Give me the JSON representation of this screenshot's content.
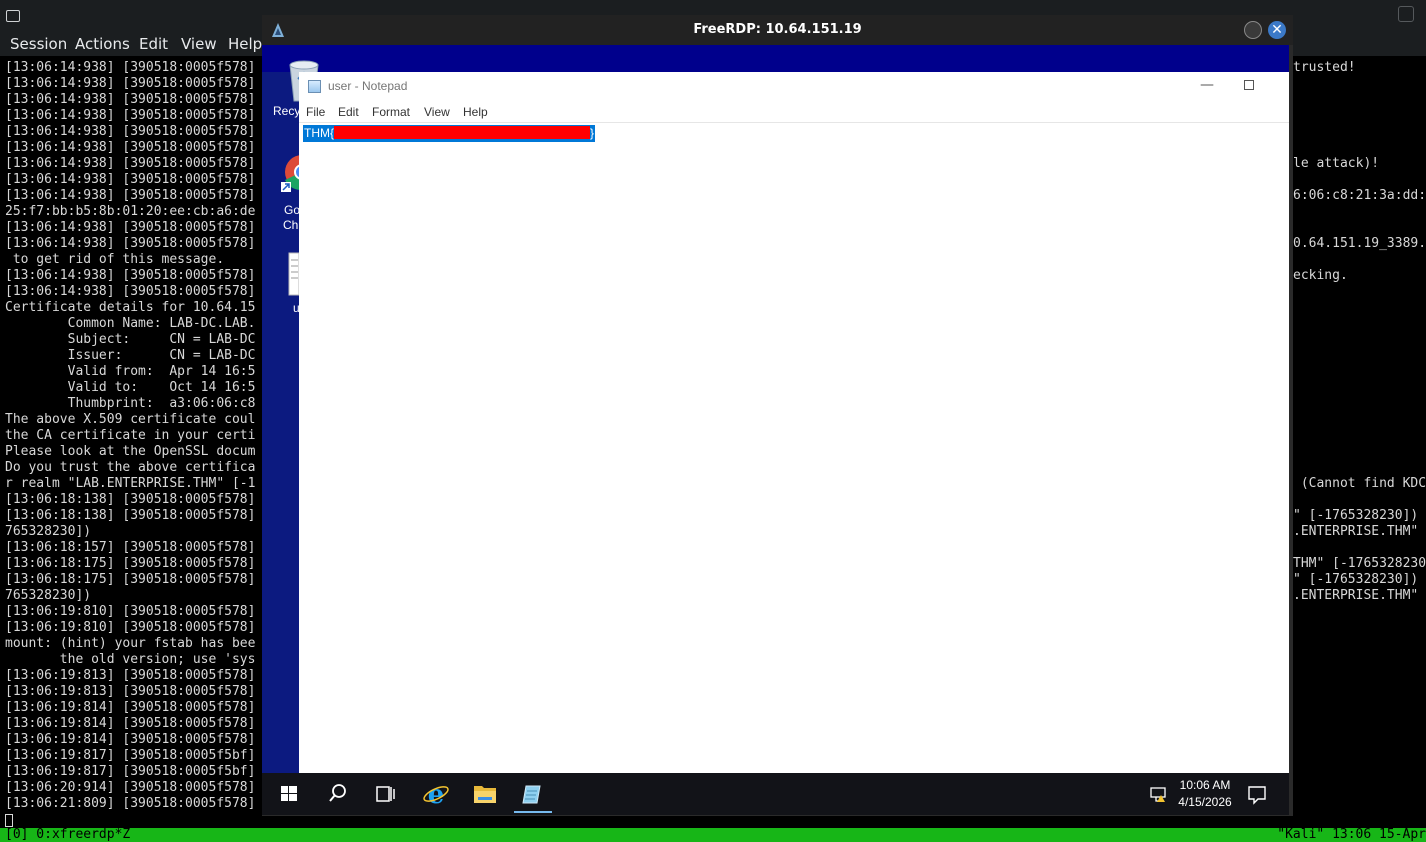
{
  "konsole": {
    "menu": [
      "Session",
      "Actions",
      "Edit",
      "View",
      "Help"
    ],
    "terminal_left_lines": [
      "[13:06:14:938] [390518:0005f578]",
      "[13:06:14:938] [390518:0005f578]",
      "[13:06:14:938] [390518:0005f578]",
      "[13:06:14:938] [390518:0005f578]",
      "[13:06:14:938] [390518:0005f578]",
      "[13:06:14:938] [390518:0005f578]",
      "[13:06:14:938] [390518:0005f578]",
      "[13:06:14:938] [390518:0005f578]",
      "[13:06:14:938] [390518:0005f578]",
      "25:f7:bb:b5:8b:01:20:ee:cb:a6:de",
      "[13:06:14:938] [390518:0005f578]",
      "[13:06:14:938] [390518:0005f578]",
      " to get rid of this message.",
      "[13:06:14:938] [390518:0005f578]",
      "[13:06:14:938] [390518:0005f578]",
      "Certificate details for 10.64.15",
      "        Common Name: LAB-DC.LAB.",
      "        Subject:     CN = LAB-DC",
      "        Issuer:      CN = LAB-DC",
      "        Valid from:  Apr 14 16:5",
      "        Valid to:    Oct 14 16:5",
      "        Thumbprint:  a3:06:06:c8",
      "The above X.509 certificate coul",
      "the CA certificate in your certi",
      "Please look at the OpenSSL docum",
      "Do you trust the above certifica",
      "r realm \"LAB.ENTERPRISE.THM\" [-1",
      "[13:06:18:138] [390518:0005f578]",
      "[13:06:18:138] [390518:0005f578]",
      "765328230])",
      "[13:06:18:157] [390518:0005f578]",
      "[13:06:18:175] [390518:0005f578]",
      "[13:06:18:175] [390518:0005f578]",
      "765328230])",
      "[13:06:19:810] [390518:0005f578]",
      "[13:06:19:810] [390518:0005f578]",
      "mount: (hint) your fstab has bee",
      "       the old version; use 'sys",
      "[13:06:19:813] [390518:0005f578]",
      "[13:06:19:813] [390518:0005f578]",
      "[13:06:19:814] [390518:0005f578]",
      "[13:06:19:814] [390518:0005f578]",
      "[13:06:19:814] [390518:0005f578]",
      "[13:06:19:817] [390518:0005f5bf]",
      "[13:06:19:817] [390518:0005f5bf]",
      "[13:06:20:914] [390518:0005f578]",
      "[13:06:21:809] [390518:0005f578]"
    ],
    "terminal_right_lines": [
      "trusted!",
      "",
      "",
      "",
      "",
      "",
      "le attack)!",
      "",
      "6:06:c8:21:3a:dd:",
      "",
      "",
      "0.64.151.19_3389.",
      "",
      "ecking.",
      "",
      "",
      "",
      "",
      "",
      "",
      "",
      "",
      "",
      "",
      "",
      "",
      " (Cannot find KDC",
      "",
      "\" [-1765328230])",
      ".ENTERPRISE.THM\"",
      "",
      "THM\" [-1765328230",
      "\" [-1765328230])",
      ".ENTERPRISE.THM\""
    ],
    "tmux_left": "[0] 0:xfreerdp*Z",
    "tmux_right": "\"Kali\" 13:06 15-Apr"
  },
  "rdp": {
    "title": "FreeRDP: 10.64.151.19",
    "desktop_labels": [
      "Recy",
      "Go",
      "Chi",
      "u"
    ],
    "notepad": {
      "title": "user - Notepad",
      "menu": [
        "File",
        "Edit",
        "Format",
        "View",
        "Help"
      ],
      "text_prefix": "THM{",
      "text_suffix": "}"
    },
    "taskbar": {
      "time": "10:06 AM",
      "date": "4/15/2026"
    }
  }
}
